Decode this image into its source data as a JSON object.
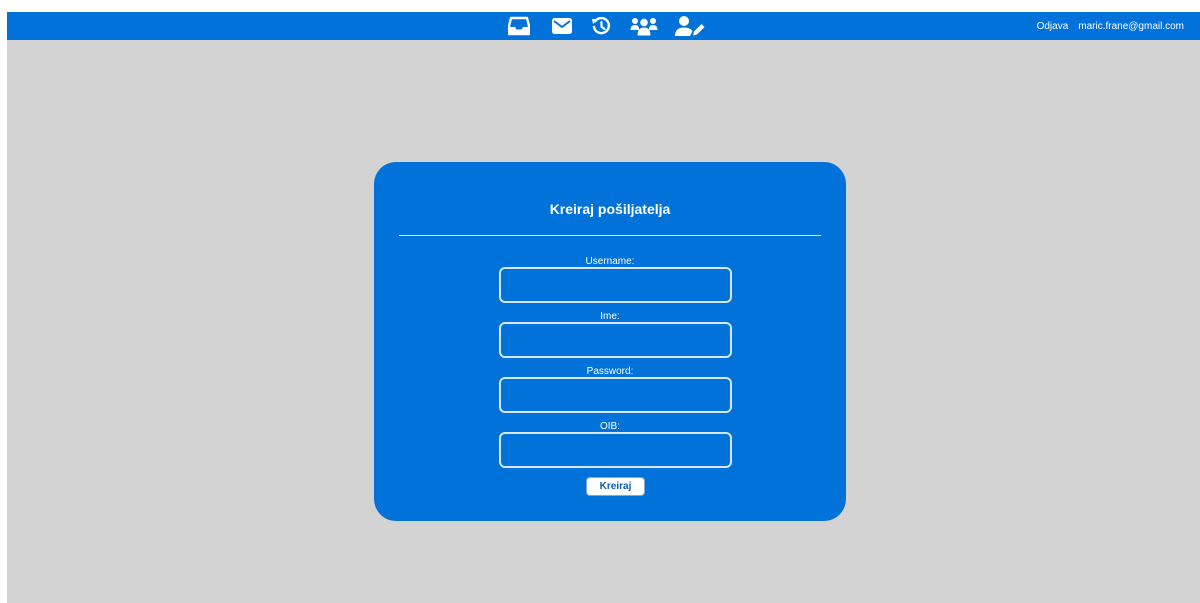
{
  "nav": {
    "icons": [
      {
        "name": "inbox-icon"
      },
      {
        "name": "mail-icon"
      },
      {
        "name": "history-icon"
      },
      {
        "name": "users-icon"
      },
      {
        "name": "user-edit-icon"
      }
    ]
  },
  "header": {
    "logout_label": "Odjava",
    "user_email": "maric.frane@gmail.com"
  },
  "form": {
    "title": "Kreiraj pošiljatelja",
    "fields": [
      {
        "label": "Username:",
        "value": ""
      },
      {
        "label": "Ime:",
        "value": ""
      },
      {
        "label": "Password:",
        "value": ""
      },
      {
        "label": "OIB:",
        "value": ""
      }
    ],
    "submit_label": "Kreiraj"
  },
  "colors": {
    "accent": "#0072d9",
    "background": "#d3d3d3",
    "text_on_accent": "#ffffff"
  }
}
